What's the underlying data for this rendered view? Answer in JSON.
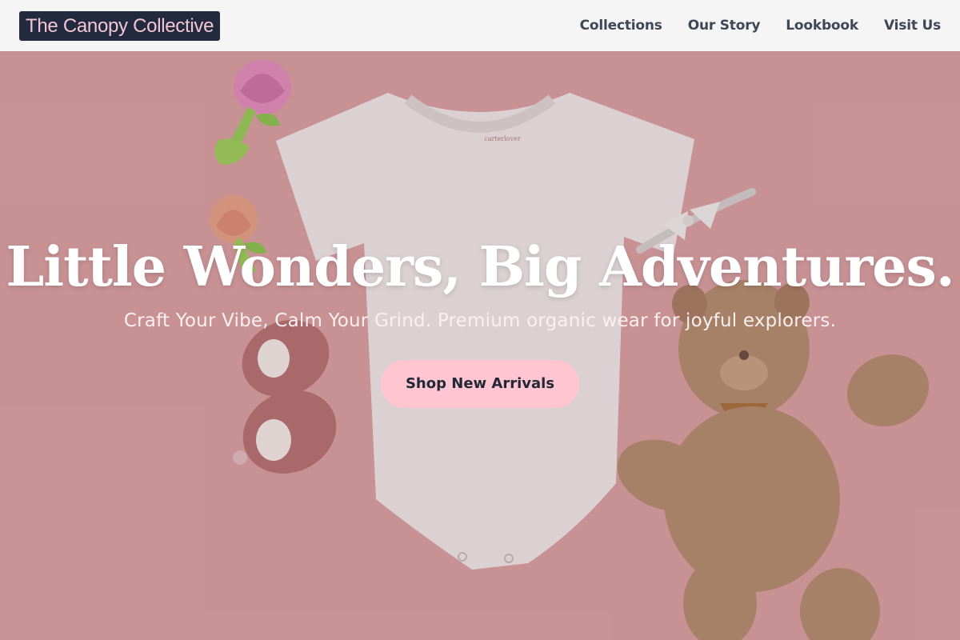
{
  "header": {
    "brand": "The Canopy Collective",
    "nav": [
      "Collections",
      "Our Story",
      "Lookbook",
      "Visit Us"
    ]
  },
  "hero": {
    "title": "Little Wonders, Big Adventures.",
    "subtitle": "Craft Your Vibe, Calm Your Grind. Premium organic wear for joyful explorers.",
    "cta_label": "Shop New Arrivals",
    "onesie_tag": "carterlover"
  },
  "colors": {
    "brand_bg": "#222a40",
    "brand_text": "#f4c6d4",
    "cta_bg": "#ffc5d1",
    "nav_text": "#3e4657",
    "hero_bg": "#d9a3a6"
  },
  "icons": [
    "teether-rattle",
    "baby-onesie",
    "bow-headband",
    "baby-booties",
    "teddy-bear"
  ]
}
